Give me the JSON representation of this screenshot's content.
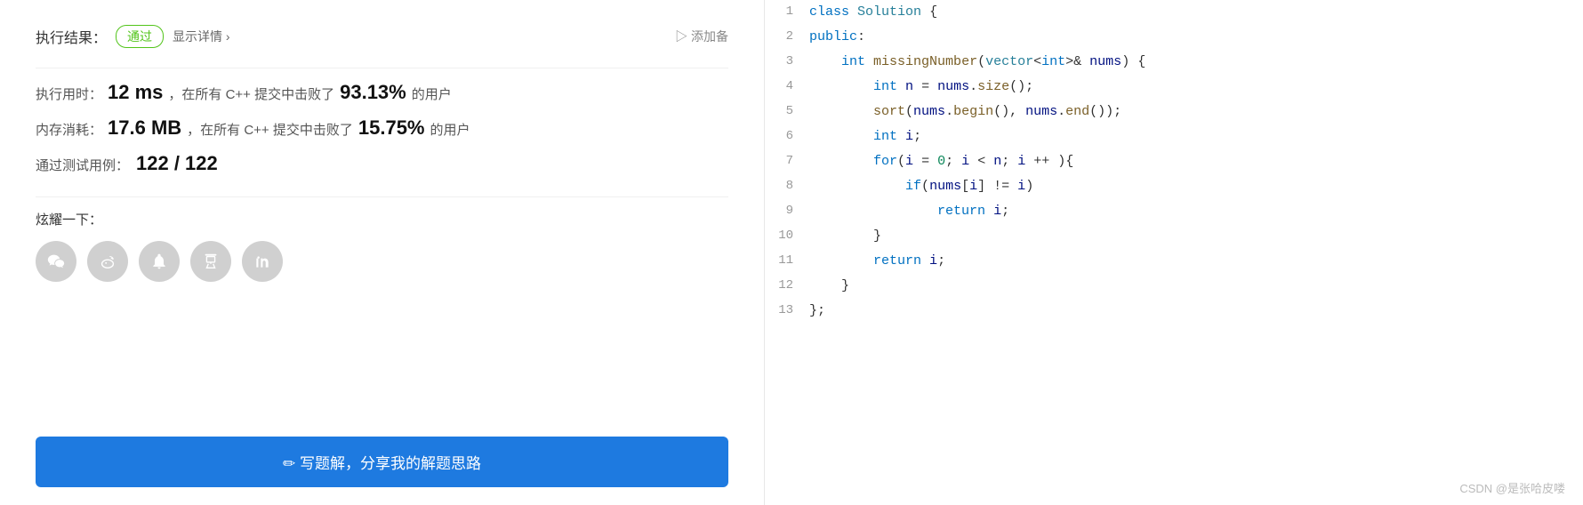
{
  "left": {
    "execution_result_label": "执行结果：",
    "pass_badge": "通过",
    "show_detail": "显示详情 ›",
    "add_note": "▷ 添加备",
    "exec_time_label": "执行用时：",
    "exec_time_value": "12 ms",
    "exec_time_suffix": "，在所有 C++ 提交中击败了",
    "exec_time_percent": "93.13%",
    "exec_time_end": "的用户",
    "memory_label": "内存消耗：",
    "memory_value": "17.6 MB",
    "memory_suffix": "，在所有 C++ 提交中击败了",
    "memory_percent": "15.75%",
    "memory_end": "的用户",
    "test_label": "通过测试用例：",
    "test_value": "122 / 122",
    "share_label": "炫耀一下：",
    "write_solution_btn": "✏ 写题解，分享我的解题思路"
  },
  "code": {
    "lines": [
      {
        "num": "1",
        "content": "class Solution {"
      },
      {
        "num": "2",
        "content": "public:"
      },
      {
        "num": "3",
        "content": "    int missingNumber(vector<int>& nums) {"
      },
      {
        "num": "4",
        "content": "        int n = nums.size();"
      },
      {
        "num": "5",
        "content": "        sort(nums.begin(), nums.end());"
      },
      {
        "num": "6",
        "content": "        int i;"
      },
      {
        "num": "7",
        "content": "        for(i = 0; i < n; i ++ ){"
      },
      {
        "num": "8",
        "content": "            if(nums[i] != i)"
      },
      {
        "num": "9",
        "content": "                return i;"
      },
      {
        "num": "10",
        "content": "        }"
      },
      {
        "num": "11",
        "content": "        return i;"
      },
      {
        "num": "12",
        "content": "    }"
      },
      {
        "num": "13",
        "content": "};"
      }
    ]
  },
  "watermark": "CSDN @是张哈皮喽"
}
